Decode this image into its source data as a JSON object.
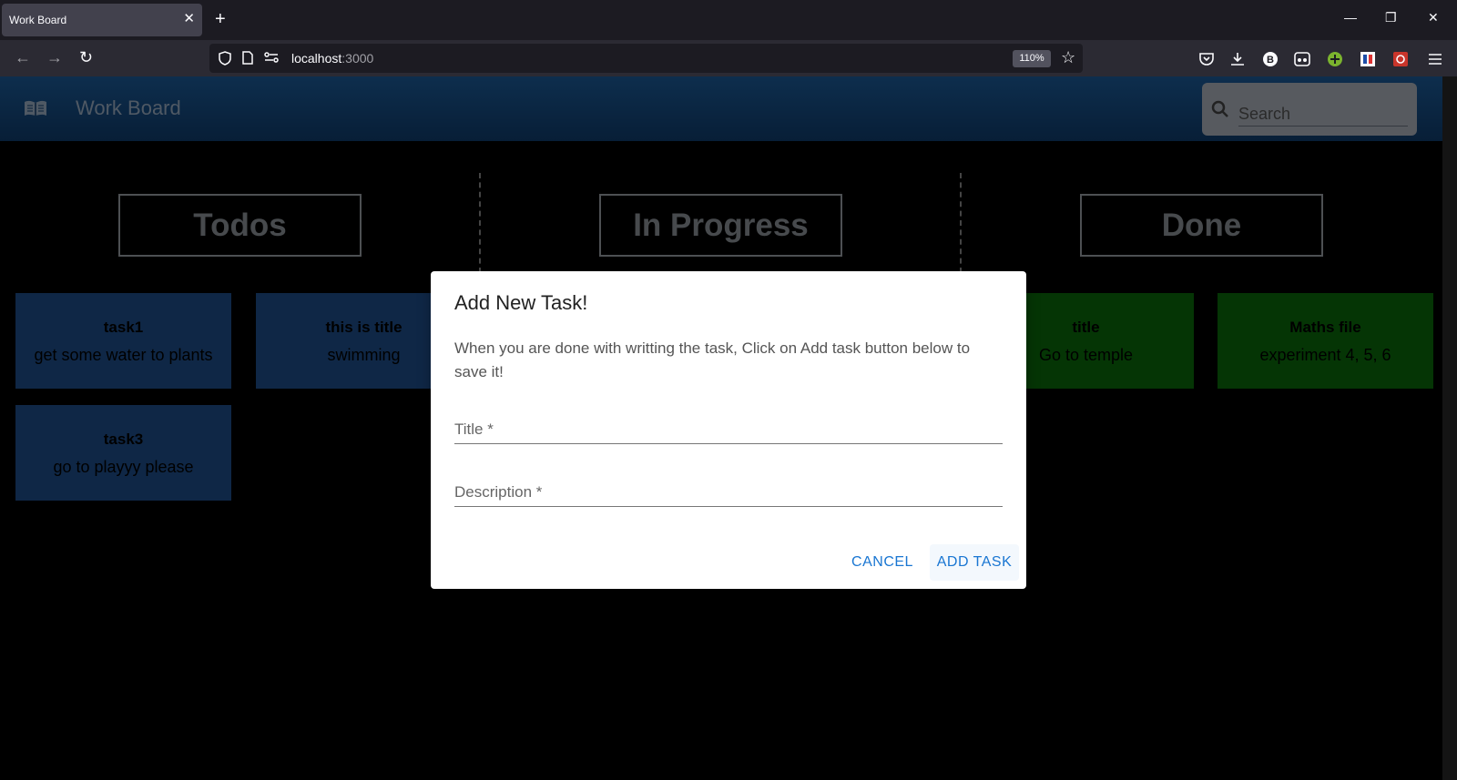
{
  "browser": {
    "tab_title": "Work Board",
    "tab_close": "✕",
    "new_tab": "+",
    "url_host": "localhost",
    "url_port": ":3000",
    "zoom": "110%"
  },
  "app": {
    "title": "Work Board",
    "search_placeholder": "Search"
  },
  "columns": [
    {
      "name": "Todos",
      "cards": [
        {
          "title": "task1",
          "description": "get some water to plants"
        },
        {
          "title": "this is title",
          "description": "swimming"
        },
        {
          "title": "task3",
          "description": "go to playyy please"
        }
      ]
    },
    {
      "name": "In Progress",
      "cards": []
    },
    {
      "name": "Done",
      "cards": [
        {
          "title": "title",
          "description": "Go to temple"
        },
        {
          "title": "Maths file",
          "description": "experiment 4, 5, 6"
        }
      ]
    }
  ],
  "colors": {
    "todo_card": "#1f4e8c",
    "done_card": "#0b6a0b",
    "appbar": "#1c5c9b",
    "accent": "#1976d2"
  },
  "dialog": {
    "title": "Add New Task!",
    "text": "When you are done with writting the task, Click on Add task button below to save it!",
    "title_label": "Title *",
    "description_label": "Description *",
    "cancel_label": "CANCEL",
    "add_label": "ADD TASK"
  }
}
